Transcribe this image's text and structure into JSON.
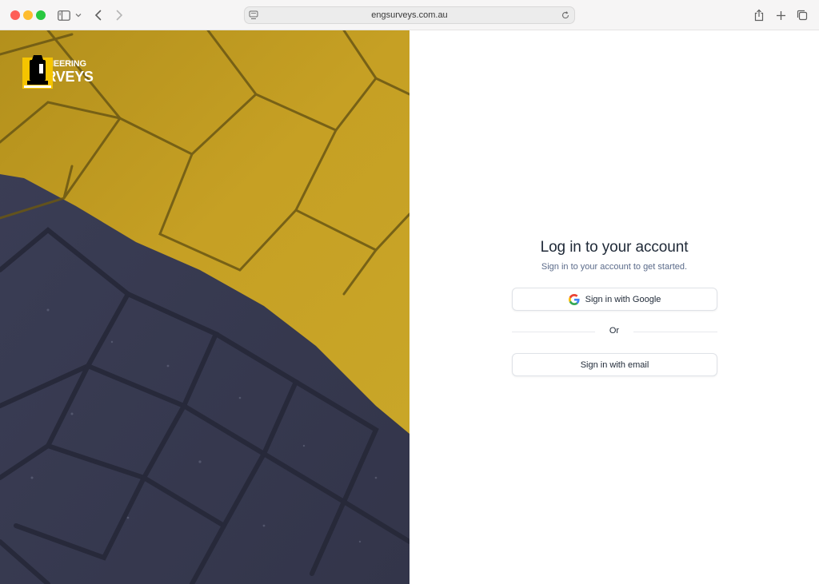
{
  "browser": {
    "url": "engsurveys.com.au",
    "icons": [
      "sidebar-icon",
      "chevron-down-icon",
      "back-icon",
      "forward-icon",
      "site-icon",
      "reload-icon",
      "share-icon",
      "plus-icon",
      "tabs-icon"
    ]
  },
  "brand": {
    "line1": "ENGINEERING",
    "line2": "SURVEYS",
    "colors": {
      "yellow": "#f5c400",
      "black": "#000000"
    }
  },
  "hero": {
    "description_colors": {
      "paving_yellow": "#c9a21f",
      "asphalt": "#3c3f55"
    }
  },
  "login": {
    "title": "Log in to your account",
    "subtitle": "Sign in to your account to get started.",
    "google_button": "Sign in with Google",
    "divider": "Or",
    "email_button": "Sign in with email"
  }
}
